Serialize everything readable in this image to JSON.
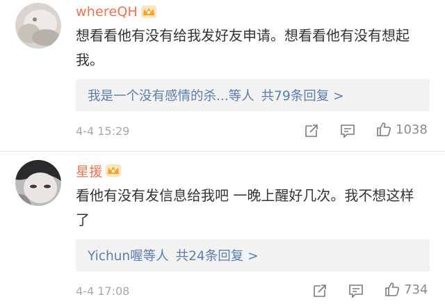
{
  "comments": [
    {
      "username": "whereQH",
      "text": "想看看他有没有给我发好友申请。想看看他有没有想起我。",
      "reply_users": "我是一个没有感情的杀...",
      "reply_etc": "等人",
      "reply_count": "共79条回复 >",
      "time": "4-4 15:29",
      "likes": "1038"
    },
    {
      "username": "星援",
      "text": "看他有没有发信息给我吧 一晚上醒好几次。我不想这样了",
      "reply_users": "Yichun喔",
      "reply_etc": "等人",
      "reply_count": "共24条回复 >",
      "time": "4-4 17:08",
      "likes": "734"
    }
  ],
  "icons": {
    "crown": "crown-badge-icon",
    "forward": "forward-icon",
    "comment": "comment-icon",
    "like": "thumbs-up-icon"
  },
  "colors": {
    "username": "#eb7350",
    "reply_link": "#5b7fa8",
    "reply_bg": "#f2f2f2",
    "meta": "#a8a8a8",
    "crown": "#f5a623"
  }
}
